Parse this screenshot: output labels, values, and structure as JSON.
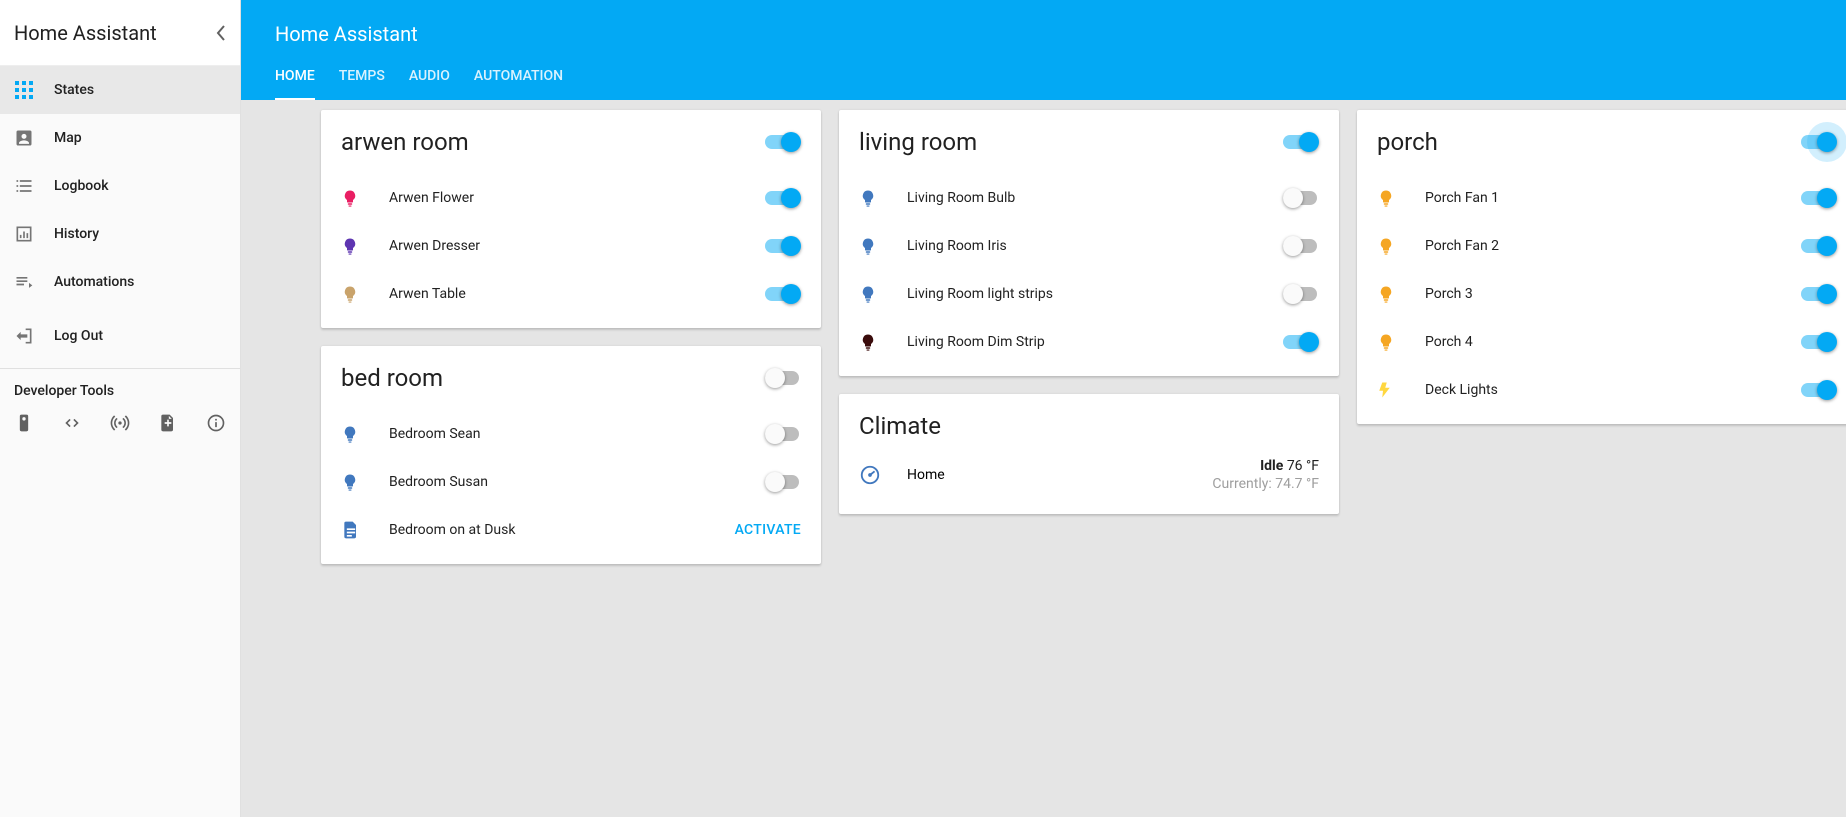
{
  "sidebar": {
    "title": "Home Assistant",
    "items": [
      {
        "label": "States",
        "icon": "apps",
        "active": true
      },
      {
        "label": "Map",
        "icon": "account-box",
        "active": false
      },
      {
        "label": "Logbook",
        "icon": "list",
        "active": false
      },
      {
        "label": "History",
        "icon": "chart",
        "active": false
      },
      {
        "label": "Automations",
        "icon": "playlist",
        "active": false
      }
    ],
    "logout": "Log Out",
    "devtools_label": "Developer Tools"
  },
  "header": {
    "title": "Home Assistant",
    "tabs": [
      {
        "label": "HOME",
        "active": true
      },
      {
        "label": "TEMPS",
        "active": false
      },
      {
        "label": "AUDIO",
        "active": false
      },
      {
        "label": "AUTOMATION",
        "active": false
      }
    ]
  },
  "colors": {
    "accent": "#03a9f4",
    "bulb_red": "#e91e63",
    "bulb_purple": "#5e35b1",
    "bulb_tan": "#c9a36b",
    "bulb_blue": "#4178be",
    "bulb_orange": "#f5a623",
    "bulb_dark": "#3a0c0c",
    "flash_yellow": "#ffd740"
  },
  "cards": {
    "arwen": {
      "title": "arwen room",
      "group_on": true,
      "entities": [
        {
          "name": "Arwen Flower",
          "icon": "bulb",
          "color_key": "bulb_red",
          "on": true
        },
        {
          "name": "Arwen Dresser",
          "icon": "bulb",
          "color_key": "bulb_purple",
          "on": true
        },
        {
          "name": "Arwen Table",
          "icon": "bulb",
          "color_key": "bulb_tan",
          "on": true
        }
      ]
    },
    "bedroom": {
      "title": "bed room",
      "group_on": false,
      "entities": [
        {
          "name": "Bedroom Sean",
          "icon": "bulb",
          "color_key": "bulb_blue",
          "on": false
        },
        {
          "name": "Bedroom Susan",
          "icon": "bulb",
          "color_key": "bulb_blue",
          "on": false
        }
      ],
      "scene": {
        "name": "Bedroom on at Dusk",
        "action": "ACTIVATE"
      }
    },
    "living": {
      "title": "living room",
      "group_on": true,
      "entities": [
        {
          "name": "Living Room Bulb",
          "icon": "bulb",
          "color_key": "bulb_blue",
          "on": false
        },
        {
          "name": "Living Room Iris",
          "icon": "bulb",
          "color_key": "bulb_blue",
          "on": false
        },
        {
          "name": "Living Room light strips",
          "icon": "bulb",
          "color_key": "bulb_blue",
          "on": false
        },
        {
          "name": "Living Room Dim Strip",
          "icon": "bulb",
          "color_key": "bulb_dark",
          "on": true
        }
      ]
    },
    "climate": {
      "title": "Climate",
      "entity": {
        "name": "Home",
        "state": "Idle",
        "target": "76 °F",
        "current_label": "Currently:",
        "current_value": "74.7 °F"
      }
    },
    "porch": {
      "title": "porch",
      "group_on": true,
      "group_glow": true,
      "entities": [
        {
          "name": "Porch Fan 1",
          "icon": "bulb",
          "color_key": "bulb_orange",
          "on": true
        },
        {
          "name": "Porch Fan 2",
          "icon": "bulb",
          "color_key": "bulb_orange",
          "on": true
        },
        {
          "name": "Porch 3",
          "icon": "bulb",
          "color_key": "bulb_orange",
          "on": true
        },
        {
          "name": "Porch 4",
          "icon": "bulb",
          "color_key": "bulb_orange",
          "on": true
        },
        {
          "name": "Deck Lights",
          "icon": "flash",
          "color_key": "flash_yellow",
          "on": true
        }
      ]
    }
  }
}
